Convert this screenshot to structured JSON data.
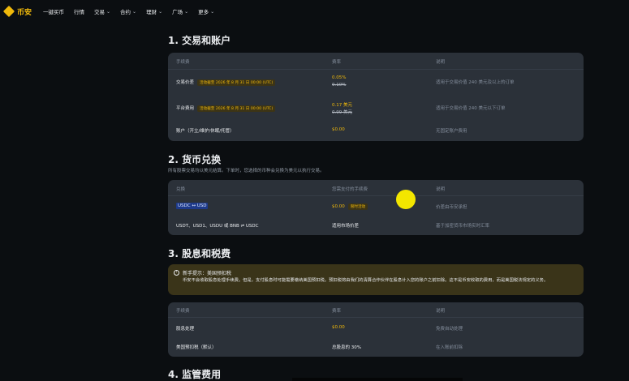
{
  "nav": {
    "logo_text": "币安",
    "items": [
      {
        "label": "一键买币",
        "has_dropdown": false
      },
      {
        "label": "行情",
        "has_dropdown": false
      },
      {
        "label": "交易",
        "has_dropdown": true
      },
      {
        "label": "合约",
        "has_dropdown": true
      },
      {
        "label": "理财",
        "has_dropdown": true
      },
      {
        "label": "广场",
        "has_dropdown": true
      },
      {
        "label": "更多",
        "has_dropdown": true
      }
    ]
  },
  "section1": {
    "title": "1. 交易和账户",
    "headers": {
      "fee": "手续费",
      "rate": "费率",
      "note": "说明"
    },
    "rows": [
      {
        "name": "交易价差",
        "tag": "活动截至 2026 年 8 月 31 日 00:00 (UTC)",
        "rate_primary": "0.05%",
        "rate_original": "0.10%",
        "note": "适用于交易价值 240 美元及以上的订单"
      },
      {
        "name": "平台费用",
        "tag": "活动截至 2026 年 8 月 31 日 00:00 (UTC)",
        "rate_primary": "0.17 美元",
        "rate_original": "0.99 美元",
        "note": "适用于交易价值 240 美元以下订单"
      },
      {
        "name": "账户（开立/维护/休眠/托管）",
        "rate_primary": "$0.00",
        "note": "无固定账户费用"
      }
    ]
  },
  "section2": {
    "title": "2. 货币兑换",
    "description": "所有股票交易均以美元结算。下单时，您选择的币种会兑换为美元以执行交易。",
    "headers": {
      "swap": "兑换",
      "fee": "您需支付的手续费",
      "note": "说明"
    },
    "rows": [
      {
        "name": "USDC ↔ USD",
        "fee": "$0.00",
        "tag": "限时活动",
        "note": "价差由币安承担"
      },
      {
        "name": "USDT、USD1、USDU 或 BNB ⇌ USDC",
        "fee": "适用市场价差",
        "note": "基于加密货币市场实时汇率"
      }
    ]
  },
  "section3": {
    "title": "3. 股息和税费",
    "notice": {
      "title": "新手提示：美国预扣税",
      "body": "币安不会收取股息处理手续费。但是，支付股息时可能需要缴纳美国预扣税。预扣税将由我们的清算合作伙伴在股息计入您的账户之前扣除。这不是币安收取的费用，而是美国税法规定的义务。"
    },
    "headers": {
      "fee": "手续费",
      "rate": "费率",
      "note": "说明"
    },
    "rows": [
      {
        "name": "股息处理",
        "rate": "$0.00",
        "note": "免费自动处理"
      },
      {
        "name": "美国预扣税（默认）",
        "rate": "总股息的 30%",
        "note": "在入账前扣除"
      }
    ]
  },
  "section4": {
    "title": "4. 监管费用"
  },
  "colors": {
    "accent": "#f0b90b",
    "background": "#0b0e11",
    "card": "#2b3139",
    "notice": "#3a3419",
    "cursor": "#f3e600"
  },
  "icons": {
    "logo": "binance-logo-icon",
    "dropdown": "chevron-down-icon",
    "info": "info-icon"
  }
}
